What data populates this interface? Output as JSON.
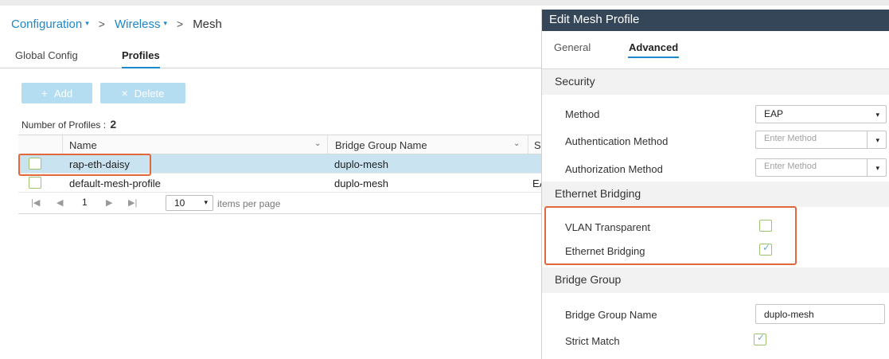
{
  "breadcrumb": {
    "items": [
      {
        "label": "Configuration",
        "has_menu": true
      },
      {
        "label": "Wireless",
        "has_menu": true
      }
    ],
    "current": "Mesh",
    "separator": ">",
    "caret": "▾"
  },
  "tabs": [
    {
      "label": "Global Config",
      "active": false
    },
    {
      "label": "Profiles",
      "active": true
    }
  ],
  "toolbar": {
    "add_icon": "+",
    "add_label": "Add",
    "delete_icon": "×",
    "delete_label": "Delete"
  },
  "profiles_count": {
    "label": "Number of Profiles :",
    "value": "2"
  },
  "table": {
    "columns": [
      "Name",
      "Bridge Group Name",
      "S"
    ],
    "rows": [
      {
        "name": "rap-eth-daisy",
        "bridge_group": "duplo-mesh",
        "extra": "",
        "selected": true
      },
      {
        "name": "default-mesh-profile",
        "bridge_group": "duplo-mesh",
        "extra": "EA",
        "selected": false
      }
    ],
    "pager": {
      "page": "1",
      "per_page": "10",
      "per_page_label": "items per page"
    }
  },
  "panel": {
    "title": "Edit Mesh Profile",
    "tabs": [
      {
        "label": "General",
        "active": false
      },
      {
        "label": "Advanced",
        "active": true
      }
    ],
    "security": {
      "heading": "Security",
      "method_label": "Method",
      "method_value": "EAP",
      "auth_method_label": "Authentication Method",
      "auth_method_placeholder": "Enter Method",
      "authz_method_label": "Authorization Method",
      "authz_method_placeholder": "Enter Method"
    },
    "ethernet_bridging": {
      "heading": "Ethernet Bridging",
      "vlan_transparent_label": "VLAN Transparent",
      "vlan_transparent_checked": false,
      "ethernet_bridging_label": "Ethernet Bridging",
      "ethernet_bridging_checked": true
    },
    "bridge_group": {
      "heading": "Bridge Group",
      "name_label": "Bridge Group Name",
      "name_value": "duplo-mesh",
      "strict_match_label": "Strict Match",
      "strict_match_checked": true
    }
  },
  "colors": {
    "accent": "#1c87c9",
    "header_bg": "#354658",
    "highlight": "#e0683a",
    "selected_row": "#c9e3f1",
    "button_disabled": "#b4ddf2"
  },
  "icons": {
    "check": "✓",
    "dropdown": "▾",
    "first_page": "|◀",
    "prev_page": "◀",
    "next_page": "▶",
    "last_page": "▶|"
  }
}
